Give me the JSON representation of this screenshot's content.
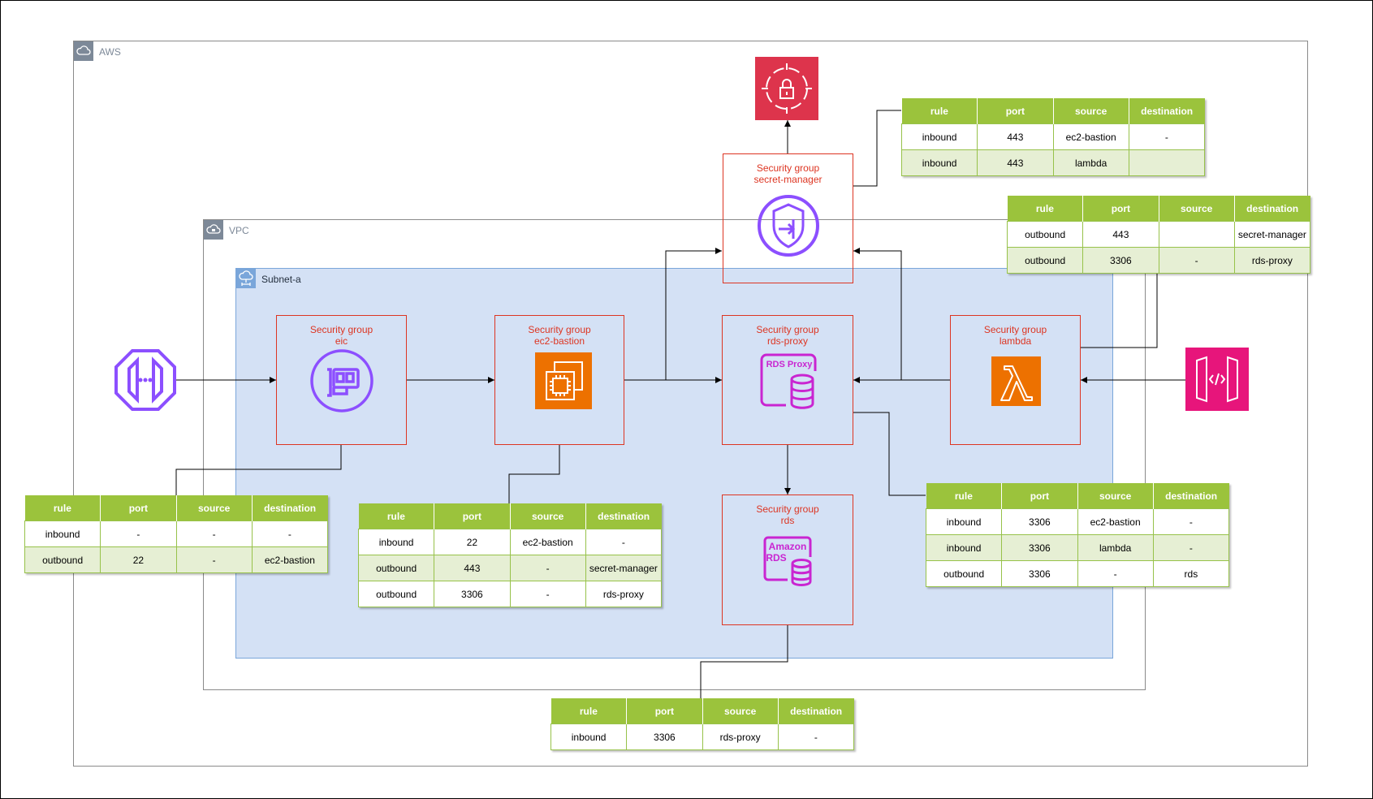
{
  "containers": {
    "aws": "AWS",
    "vpc": "VPC",
    "subnet": "Subnet-a"
  },
  "security_groups": {
    "secret_manager": [
      "Security group",
      "secret-manager"
    ],
    "eic": [
      "Security group",
      "eic"
    ],
    "ec2_bastion": [
      "Security group",
      "ec2-bastion"
    ],
    "rds_proxy": [
      "Security group",
      "rds-proxy"
    ],
    "lambda": [
      "Security group",
      "lambda"
    ],
    "rds": [
      "Security group",
      "rds"
    ]
  },
  "icon_labels": {
    "rds_proxy": "RDS Proxy",
    "rds": [
      "Amazon",
      "RDS"
    ]
  },
  "icons": {
    "secrets_manager": "secrets-manager-icon",
    "eic_endpoint": "instance-connect-endpoint-icon",
    "network_interface": "network-interface-icon",
    "ec2": "ec2-instance-icon",
    "rds_proxy": "rds-proxy-icon",
    "lambda": "lambda-icon",
    "api_gateway": "api-gateway-icon",
    "rds": "amazon-rds-icon",
    "privatelink": "privatelink-shield-icon",
    "cloud": "cloud-icon"
  },
  "colors": {
    "security_group": "#dd3522",
    "table_header": "#9bc33c",
    "table_row_alt": "#e6efd4",
    "subnet_fill": "#d4e1f5",
    "secrets_manager": "#dd344c",
    "compute": "#ed7100",
    "network": "#8c4fff",
    "database": "#c925d1",
    "api_gateway": "#e7157b"
  },
  "tables": {
    "secret_manager": {
      "headers": [
        "rule",
        "port",
        "source",
        "destination"
      ],
      "rows": [
        [
          "inbound",
          "443",
          "ec2-bastion",
          "-"
        ],
        [
          "inbound",
          "443",
          "lambda",
          ""
        ]
      ]
    },
    "lambda": {
      "headers": [
        "rule",
        "port",
        "source",
        "destination"
      ],
      "rows": [
        [
          "outbound",
          "443",
          "",
          "secret-manager"
        ],
        [
          "outbound",
          "3306",
          "-",
          "rds-proxy"
        ]
      ]
    },
    "eic": {
      "headers": [
        "rule",
        "port",
        "source",
        "destination"
      ],
      "rows": [
        [
          "inbound",
          "-",
          "-",
          "-"
        ],
        [
          "outbound",
          "22",
          "-",
          "ec2-bastion"
        ]
      ]
    },
    "ec2_bastion": {
      "headers": [
        "rule",
        "port",
        "source",
        "destination"
      ],
      "rows": [
        [
          "inbound",
          "22",
          "ec2-bastion",
          "-"
        ],
        [
          "outbound",
          "443",
          "-",
          "secret-manager"
        ],
        [
          "outbound",
          "3306",
          "-",
          "rds-proxy"
        ]
      ]
    },
    "rds_proxy": {
      "headers": [
        "rule",
        "port",
        "source",
        "destination"
      ],
      "rows": [
        [
          "inbound",
          "3306",
          "ec2-bastion",
          "-"
        ],
        [
          "inbound",
          "3306",
          "lambda",
          "-"
        ],
        [
          "outbound",
          "3306",
          "-",
          "rds"
        ]
      ]
    },
    "rds": {
      "headers": [
        "rule",
        "port",
        "source",
        "destination"
      ],
      "rows": [
        [
          "inbound",
          "3306",
          "rds-proxy",
          "-"
        ]
      ]
    }
  }
}
